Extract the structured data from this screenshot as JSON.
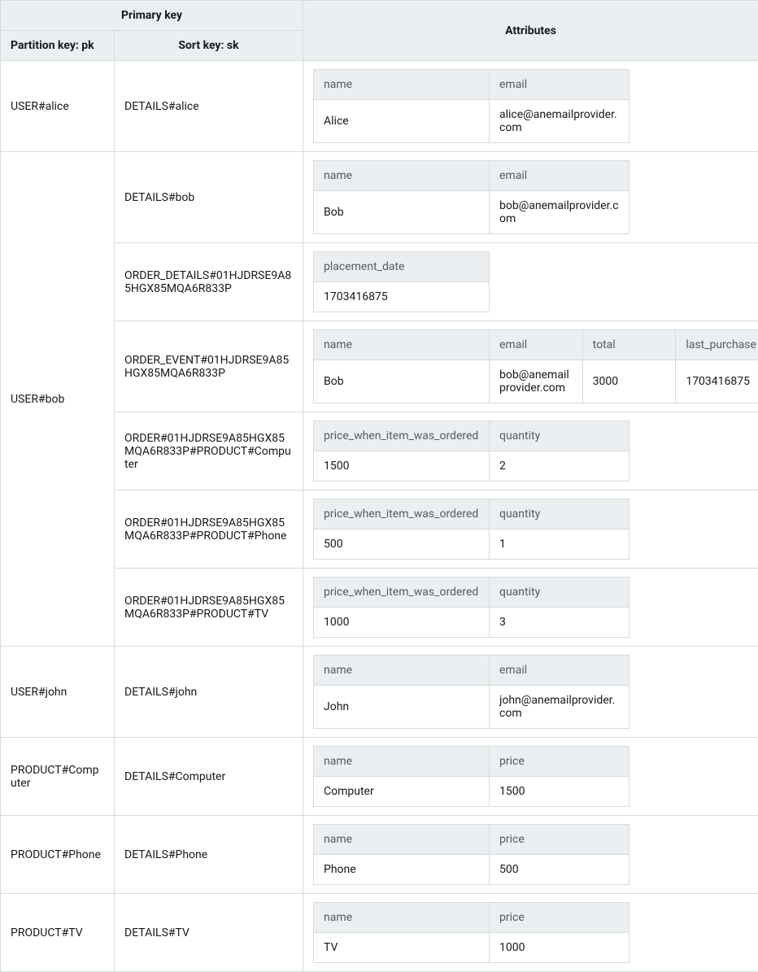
{
  "header": {
    "primary_key_label": "Primary key",
    "partition_key_label": "Partition key: pk",
    "sort_key_label": "Sort key: sk",
    "attributes_label": "Attributes"
  },
  "blocks": [
    {
      "pk": "USER#alice",
      "rows": [
        {
          "sk": "DETAILS#alice",
          "attrs": [
            {
              "label": "name",
              "value": "Alice"
            },
            {
              "label": "email",
              "value": "alice@anemailprovider.com"
            }
          ],
          "slots": 3
        }
      ]
    },
    {
      "pk": "USER#bob",
      "rows": [
        {
          "sk": "DETAILS#bob",
          "attrs": [
            {
              "label": "name",
              "value": "Bob"
            },
            {
              "label": "email",
              "value": "bob@anemailprovider.com"
            }
          ],
          "slots": 3
        },
        {
          "sk": "ORDER_DETAILS#01HJDRSE9A85HGX85MQA6R833P",
          "attrs": [
            {
              "label": "placement_date",
              "value": "1703416875"
            }
          ],
          "slots": 3
        },
        {
          "sk": "ORDER_EVENT#01HJDRSE9A85HGX85MQA6R833P",
          "attrs": [
            {
              "label": "name",
              "value": "Bob"
            },
            {
              "label": "email",
              "value": "bob@anemailprovider.com"
            },
            {
              "label": "total",
              "value": "3000"
            },
            {
              "label": "last_purchase",
              "value": "1703416875"
            }
          ],
          "slots": 4
        },
        {
          "sk": "ORDER#01HJDRSE9A85HGX85MQA6R833P#PRODUCT#Computer",
          "attrs": [
            {
              "label": "price_when_item_was_ordered",
              "value": "1500"
            },
            {
              "label": "quantity",
              "value": "2"
            }
          ],
          "slots": 3
        },
        {
          "sk": "ORDER#01HJDRSE9A85HGX85MQA6R833P#PRODUCT#Phone",
          "attrs": [
            {
              "label": "price_when_item_was_ordered",
              "value": "500"
            },
            {
              "label": "quantity",
              "value": "1"
            }
          ],
          "slots": 3
        },
        {
          "sk": "ORDER#01HJDRSE9A85HGX85MQA6R833P#PRODUCT#TV",
          "attrs": [
            {
              "label": "price_when_item_was_ordered",
              "value": "1000"
            },
            {
              "label": "quantity",
              "value": "3"
            }
          ],
          "slots": 3
        }
      ]
    },
    {
      "pk": "USER#john",
      "rows": [
        {
          "sk": "DETAILS#john",
          "attrs": [
            {
              "label": "name",
              "value": "John"
            },
            {
              "label": "email",
              "value": "john@anemailprovider.com"
            }
          ],
          "slots": 3
        }
      ]
    },
    {
      "pk": "PRODUCT#Computer",
      "rows": [
        {
          "sk": "DETAILS#Computer",
          "attrs": [
            {
              "label": "name",
              "value": "Computer"
            },
            {
              "label": "price",
              "value": "1500"
            }
          ],
          "slots": 3
        }
      ]
    },
    {
      "pk": "PRODUCT#Phone",
      "rows": [
        {
          "sk": "DETAILS#Phone",
          "attrs": [
            {
              "label": "name",
              "value": "Phone"
            },
            {
              "label": "price",
              "value": "500"
            }
          ],
          "slots": 3
        }
      ]
    },
    {
      "pk": "PRODUCT#TV",
      "rows": [
        {
          "sk": "DETAILS#TV",
          "attrs": [
            {
              "label": "name",
              "value": "TV"
            },
            {
              "label": "price",
              "value": "1000"
            }
          ],
          "slots": 3
        }
      ]
    }
  ]
}
